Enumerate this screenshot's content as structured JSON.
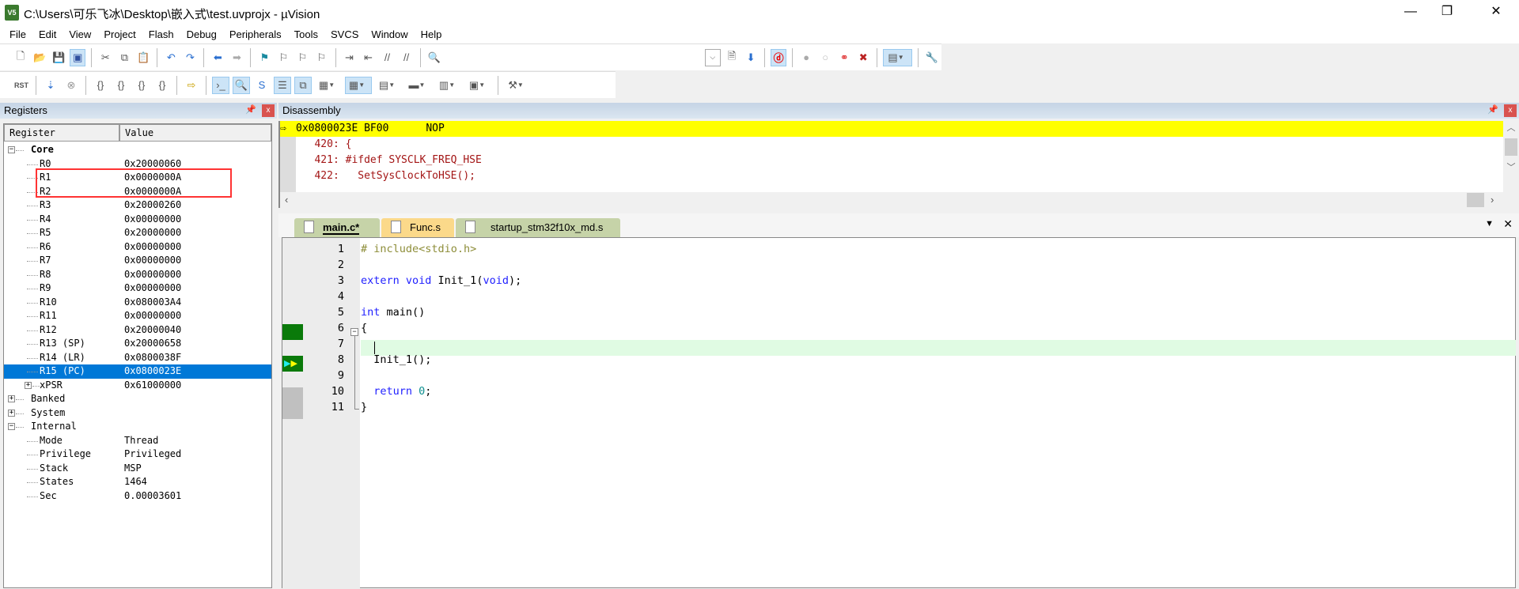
{
  "window": {
    "title": "C:\\Users\\可乐飞冰\\Desktop\\嵌入式\\test.uvprojx - µVision",
    "app_icon": "uvision-logo"
  },
  "menu": [
    "File",
    "Edit",
    "View",
    "Project",
    "Flash",
    "Debug",
    "Peripherals",
    "Tools",
    "SVCS",
    "Window",
    "Help"
  ],
  "registers": {
    "title": "Registers",
    "columns": [
      "Register",
      "Value"
    ],
    "core_label": "Core",
    "core": [
      {
        "name": "R0",
        "value": "0x20000060"
      },
      {
        "name": "R1",
        "value": "0x0000000A"
      },
      {
        "name": "R2",
        "value": "0x0000000A"
      },
      {
        "name": "R3",
        "value": "0x20000260"
      },
      {
        "name": "R4",
        "value": "0x00000000"
      },
      {
        "name": "R5",
        "value": "0x20000000"
      },
      {
        "name": "R6",
        "value": "0x00000000"
      },
      {
        "name": "R7",
        "value": "0x00000000"
      },
      {
        "name": "R8",
        "value": "0x00000000"
      },
      {
        "name": "R9",
        "value": "0x00000000"
      },
      {
        "name": "R10",
        "value": "0x080003A4"
      },
      {
        "name": "R11",
        "value": "0x00000000"
      },
      {
        "name": "R12",
        "value": "0x20000040"
      },
      {
        "name": "R13 (SP)",
        "value": "0x20000658"
      },
      {
        "name": "R14 (LR)",
        "value": "0x0800038F"
      },
      {
        "name": "R15 (PC)",
        "value": "0x0800023E",
        "selected": true
      },
      {
        "name": "xPSR",
        "value": "0x61000000"
      }
    ],
    "groups": [
      "Banked",
      "System",
      "Internal"
    ],
    "internal": [
      {
        "name": "Mode",
        "value": "Thread"
      },
      {
        "name": "Privilege",
        "value": "Privileged"
      },
      {
        "name": "Stack",
        "value": "MSP"
      },
      {
        "name": "States",
        "value": "1464"
      },
      {
        "name": "Sec",
        "value": "0.00003601"
      }
    ],
    "highlight_color": "#ff3333"
  },
  "disassembly": {
    "title": "Disassembly",
    "lines": [
      "0x0800023E BF00      NOP",
      "   420: {",
      "   421: #ifdef SYSCLK_FREQ_HSE",
      "   422:   SetSysClockToHSE();"
    ]
  },
  "tabs": [
    {
      "label": "main.c*",
      "active": true
    },
    {
      "label": "Func.s"
    },
    {
      "label": "startup_stm32f10x_md.s"
    }
  ],
  "editor": {
    "lines": [
      {
        "n": "1",
        "parts": [
          [
            "pp",
            "# include<stdio.h>"
          ]
        ]
      },
      {
        "n": "2",
        "parts": []
      },
      {
        "n": "3",
        "parts": [
          [
            "kw",
            "extern void "
          ],
          [
            "",
            "Init_1("
          ],
          [
            "kw",
            "void"
          ],
          [
            "",
            ");"
          ]
        ]
      },
      {
        "n": "4",
        "parts": []
      },
      {
        "n": "5",
        "parts": [
          [
            "kw",
            "int "
          ],
          [
            "",
            "main()"
          ]
        ]
      },
      {
        "n": "6",
        "parts": [
          [
            "",
            "{"
          ]
        ]
      },
      {
        "n": "7",
        "parts": []
      },
      {
        "n": "8",
        "parts": [
          [
            "",
            "  Init_1();"
          ]
        ]
      },
      {
        "n": "9",
        "parts": []
      },
      {
        "n": "10",
        "parts": [
          [
            "kw",
            "  return "
          ],
          [
            "num",
            "0"
          ],
          [
            "",
            ";"
          ]
        ]
      },
      {
        "n": "11",
        "parts": [
          [
            "",
            "}"
          ]
        ]
      }
    ]
  }
}
